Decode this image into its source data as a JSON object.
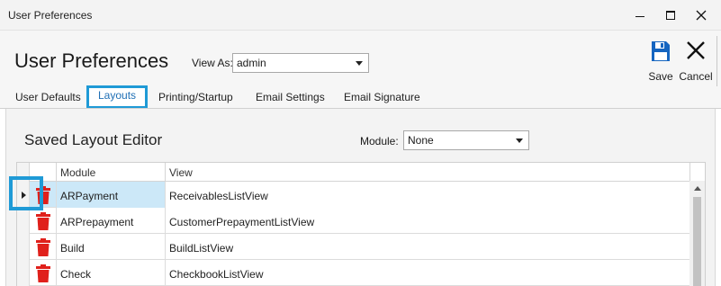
{
  "window": {
    "title": "User Preferences"
  },
  "header": {
    "title": "User Preferences",
    "view_as_label": "View As:",
    "view_as_value": "admin",
    "save_label": "Save",
    "cancel_label": "Cancel"
  },
  "tabs": [
    {
      "label": "User Defaults",
      "active": false
    },
    {
      "label": "Layouts",
      "active": true
    },
    {
      "label": "Printing/Startup",
      "active": false
    },
    {
      "label": "Email Settings",
      "active": false
    },
    {
      "label": "Email Signature",
      "active": false
    }
  ],
  "editor": {
    "title": "Saved Layout Editor",
    "module_label": "Module:",
    "module_value": "None"
  },
  "grid": {
    "columns": [
      "Module",
      "View"
    ],
    "rows": [
      {
        "module": "ARPayment",
        "view": "ReceivablesListView",
        "selected": true
      },
      {
        "module": "ARPrepayment",
        "view": "CustomerPrepaymentListView",
        "selected": false
      },
      {
        "module": "Build",
        "view": "BuildListView",
        "selected": false
      },
      {
        "module": "Check",
        "view": "CheckbookListView",
        "selected": false
      }
    ]
  },
  "colors": {
    "accent": "#1f9ad6",
    "trash": "#e0201b",
    "save_icon": "#1565c0",
    "selected_row": "#cce8f8"
  },
  "icons": {
    "save": "floppy-disk-icon",
    "cancel": "close-x-icon",
    "delete": "trash-icon"
  }
}
